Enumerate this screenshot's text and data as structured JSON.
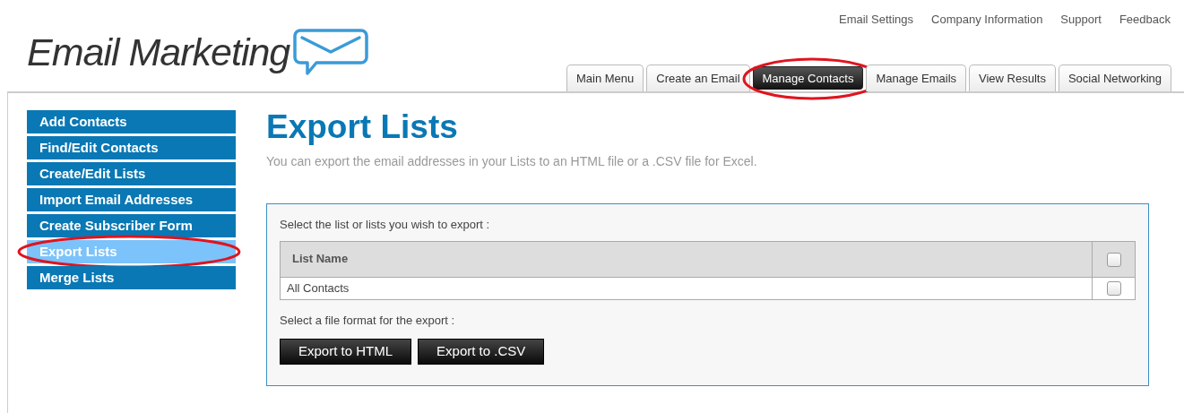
{
  "logo": {
    "text": "Email Marketing"
  },
  "top_links": [
    "Email Settings",
    "Company Information",
    "Support",
    "Feedback"
  ],
  "tabs": [
    {
      "label": "Main Menu",
      "selected": false,
      "circled": false
    },
    {
      "label": "Create an Email",
      "selected": false,
      "circled": false
    },
    {
      "label": "Manage Contacts",
      "selected": true,
      "circled": true
    },
    {
      "label": "Manage Emails",
      "selected": false,
      "circled": false
    },
    {
      "label": "View Results",
      "selected": false,
      "circled": false
    },
    {
      "label": "Social Networking",
      "selected": false,
      "circled": false
    }
  ],
  "sidebar": {
    "items": [
      {
        "label": "Add Contacts",
        "selected": false,
        "circled": false
      },
      {
        "label": "Find/Edit Contacts",
        "selected": false,
        "circled": false
      },
      {
        "label": "Create/Edit Lists",
        "selected": false,
        "circled": false
      },
      {
        "label": "Import Email Addresses",
        "selected": false,
        "circled": false
      },
      {
        "label": "Create Subscriber Form",
        "selected": false,
        "circled": false
      },
      {
        "label": "Export Lists",
        "selected": true,
        "circled": true
      },
      {
        "label": "Merge Lists",
        "selected": false,
        "circled": false
      }
    ]
  },
  "page": {
    "title": "Export Lists",
    "description": "You can export the email addresses in your Lists to an HTML file or a .CSV file for Excel."
  },
  "panel": {
    "list_prompt": "Select the list or lists you wish to export :",
    "table": {
      "columns": [
        {
          "label": "List Name"
        }
      ],
      "header_checked": false,
      "rows": [
        {
          "name": "All Contacts",
          "checked": false
        }
      ]
    },
    "format_prompt": "Select a file format for the export :",
    "buttons": [
      "Export to HTML",
      "Export to .CSV"
    ]
  }
}
